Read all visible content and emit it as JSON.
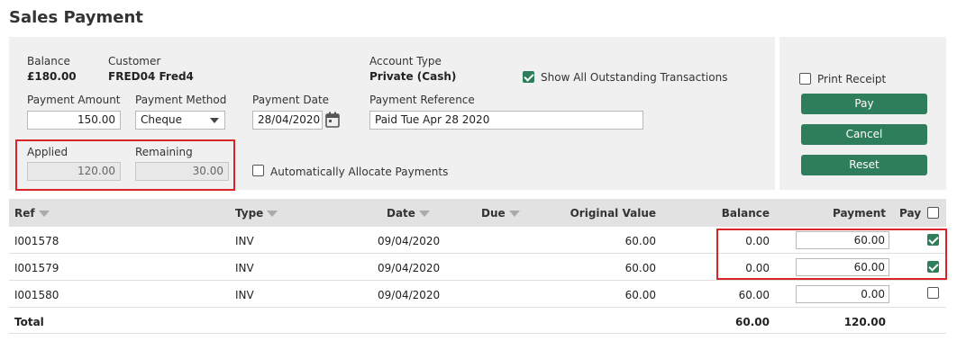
{
  "page": {
    "title": "Sales Payment"
  },
  "summary": {
    "balance_label": "Balance",
    "balance_value": "£180.00",
    "customer_label": "Customer",
    "customer_value": "FRED04 Fred4",
    "account_type_label": "Account Type",
    "account_type_value": "Private (Cash)",
    "show_all_label": "Show All Outstanding Transactions",
    "show_all_checked": true
  },
  "form": {
    "payment_amount_label": "Payment Amount",
    "payment_amount_value": "150.00",
    "payment_method_label": "Payment Method",
    "payment_method_value": "Cheque",
    "payment_date_label": "Payment Date",
    "payment_date_value": "28/04/2020",
    "payment_reference_label": "Payment Reference",
    "payment_reference_value": "Paid Tue Apr 28 2020",
    "applied_label": "Applied",
    "applied_value": "120.00",
    "remaining_label": "Remaining",
    "remaining_value": "30.00",
    "auto_allocate_label": "Automatically Allocate Payments",
    "auto_allocate_checked": false
  },
  "actions": {
    "print_receipt_label": "Print Receipt",
    "print_receipt_checked": false,
    "pay_label": "Pay",
    "cancel_label": "Cancel",
    "reset_label": "Reset"
  },
  "table": {
    "headers": {
      "ref": "Ref",
      "type": "Type",
      "date": "Date",
      "due": "Due",
      "original_value": "Original Value",
      "balance": "Balance",
      "payment": "Payment",
      "pay": "Pay"
    },
    "rows": [
      {
        "ref": "I001578",
        "type": "INV",
        "date": "09/04/2020",
        "due": "",
        "original_value": "60.00",
        "balance": "0.00",
        "payment": "60.00",
        "pay": true
      },
      {
        "ref": "I001579",
        "type": "INV",
        "date": "09/04/2020",
        "due": "",
        "original_value": "60.00",
        "balance": "0.00",
        "payment": "60.00",
        "pay": true
      },
      {
        "ref": "I001580",
        "type": "INV",
        "date": "09/04/2020",
        "due": "",
        "original_value": "60.00",
        "balance": "60.00",
        "payment": "0.00",
        "pay": false
      }
    ],
    "total": {
      "label": "Total",
      "balance": "60.00",
      "payment": "120.00"
    }
  },
  "colors": {
    "accent": "#2e7d5b",
    "highlight": "#d7262a",
    "panel": "#f0f0f0"
  }
}
